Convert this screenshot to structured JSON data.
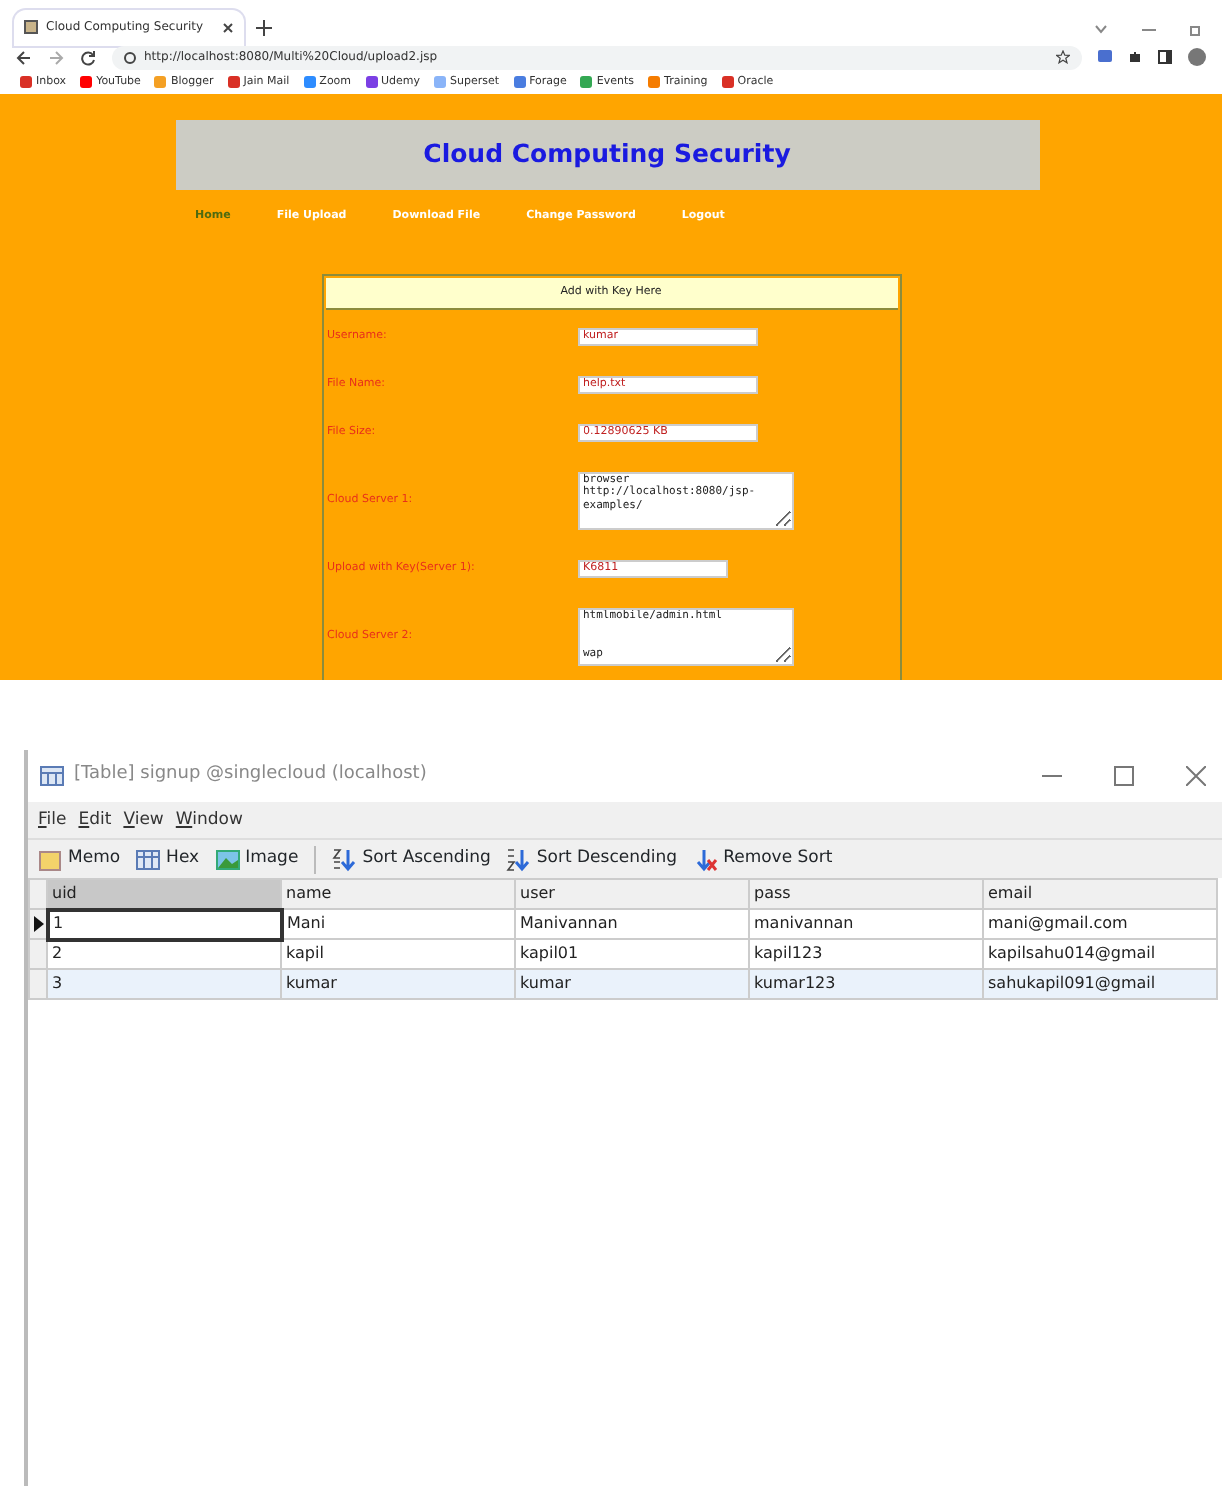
{
  "browser": {
    "tab_title": "Cloud Computing Security",
    "url": "http://localhost:8080/Multi%20Cloud/upload2.jsp",
    "bookmarks": [
      "Inbox",
      "YouTube",
      "Blogger",
      "Jain Mail",
      "Zoom",
      "Udemy",
      "Superset",
      "Forage",
      "Events",
      "Training",
      "Oracle"
    ]
  },
  "page": {
    "title": "Cloud Computing Security",
    "nav": [
      {
        "label": "Home",
        "selected": true
      },
      {
        "label": "File Upload",
        "selected": false
      },
      {
        "label": "Download File",
        "selected": false
      },
      {
        "label": "Change Password",
        "selected": false
      },
      {
        "label": "Logout",
        "selected": false
      }
    ],
    "form": {
      "heading": "Add with Key Here",
      "fields": [
        {
          "label": "Username:",
          "kind": "input",
          "value": "kumar"
        },
        {
          "label": "File Name:",
          "kind": "input",
          "value": "help.txt"
        },
        {
          "label": "File Size:",
          "kind": "input",
          "value": "0.12890625 KB"
        },
        {
          "label": "Cloud Server 1:",
          "kind": "textarea",
          "value": "browser\nhttp://localhost:8080/jsp-examples/"
        },
        {
          "label": "Upload with Key(Server 1):",
          "kind": "short",
          "value": "K6811"
        },
        {
          "label": "Cloud Server 2:",
          "kind": "textarea",
          "value": "htmlmobile/admin.html\n\n\nwap"
        }
      ]
    }
  },
  "table_window": {
    "title": "[Table] signup @singlecloud (localhost)",
    "menu": [
      "File",
      "Edit",
      "View",
      "Window"
    ],
    "toolbar": [
      "Memo",
      "Hex",
      "Image",
      "Sort Ascending",
      "Sort Descending",
      "Remove Sort"
    ],
    "columns": [
      "uid",
      "name",
      "user",
      "pass",
      "email"
    ],
    "rows": [
      {
        "cells": [
          "1",
          "Mani",
          "Manivannan",
          "manivannan",
          "mani@gmail.com"
        ],
        "selected": true,
        "highlighted": false
      },
      {
        "cells": [
          "2",
          "kapil",
          "kapil01",
          "kapil123",
          "kapilsahu014@gmail"
        ],
        "selected": false,
        "highlighted": false
      },
      {
        "cells": [
          "3",
          "kumar",
          "kumar",
          "kumar123",
          "sahukapil091@gmail"
        ],
        "selected": false,
        "highlighted": true
      }
    ]
  }
}
